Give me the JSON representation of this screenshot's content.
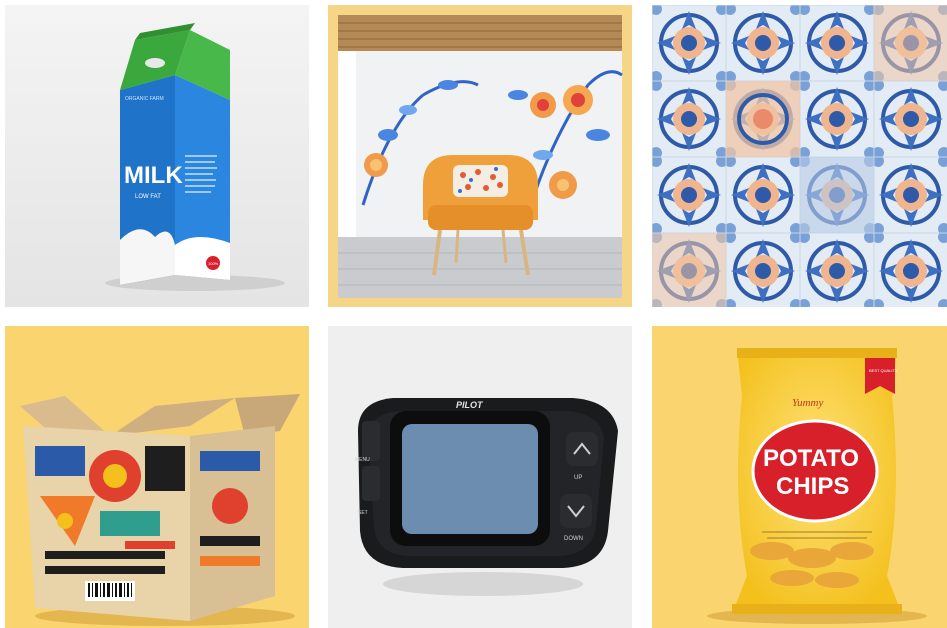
{
  "gallery": {
    "tiles": [
      {
        "subject": "milk carton",
        "texts": {
          "brand_small": "ORGANIC FARM",
          "main": "MILK",
          "sub": "LOW FAT",
          "badge": "100%"
        }
      },
      {
        "subject": "orange armchair in front of floral mural wall",
        "texts": {}
      },
      {
        "subject": "blue and orange ornamental tiles",
        "texts": {}
      },
      {
        "subject": "open printed cardboard box",
        "texts": {}
      },
      {
        "subject": "black GPS device",
        "texts": {
          "brand": "PILOT",
          "menu": "MENU",
          "set": "SET",
          "up": "UP",
          "down": "DOWN"
        }
      },
      {
        "subject": "potato chips bag",
        "texts": {
          "brand": "Yummy",
          "line1": "POTATO",
          "line2": "CHIPS",
          "ribbon": "BEST QUALITY"
        }
      }
    ]
  },
  "colors": {
    "milk_green": "#3aa83c",
    "milk_blue": "#1f73c9",
    "chips_red": "#d8202a",
    "chips_yellow": "#f3c01c",
    "device_black": "#1a1b1d",
    "screen_blue": "#6c8db0",
    "chair_orange": "#f0a03a",
    "tile_blue": "#2f5aa8"
  }
}
